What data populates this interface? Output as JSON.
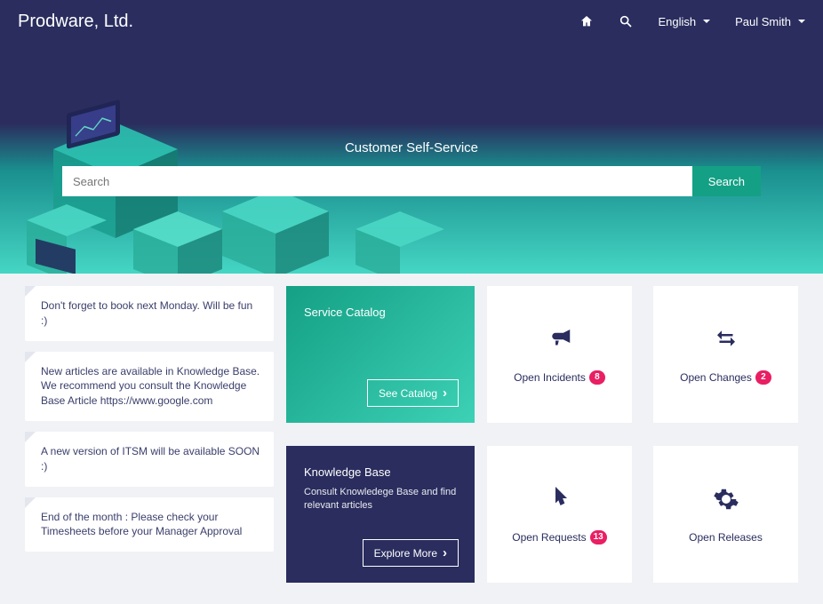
{
  "header": {
    "brand": "Prodware, Ltd.",
    "language": "English",
    "user": "Paul Smith"
  },
  "hero": {
    "title": "Customer Self-Service",
    "search_placeholder": "Search",
    "search_button": "Search"
  },
  "notices": [
    {
      "text": "Don't forget to book next Monday. Will be fun :)"
    },
    {
      "text": "New articles are available in Knowledge Base. We recommend you consult the Knowledge Base Article https://www.google.com"
    },
    {
      "text": "A new version of ITSM will be available SOON :)"
    },
    {
      "text": "End of the month : Please check your Timesheets before your Manager Approval"
    }
  ],
  "feature_cards": {
    "catalog": {
      "title": "Service Catalog",
      "button": "See Catalog"
    },
    "kb": {
      "title": "Knowledge Base",
      "subtitle": "Consult Knowledege Base and find relevant articles",
      "button": "Explore More"
    }
  },
  "stats": {
    "incidents": {
      "label": "Open Incidents",
      "count": "8"
    },
    "changes": {
      "label": "Open Changes",
      "count": "2"
    },
    "requests": {
      "label": "Open Requests",
      "count": "13"
    },
    "releases": {
      "label": "Open Releases"
    }
  }
}
